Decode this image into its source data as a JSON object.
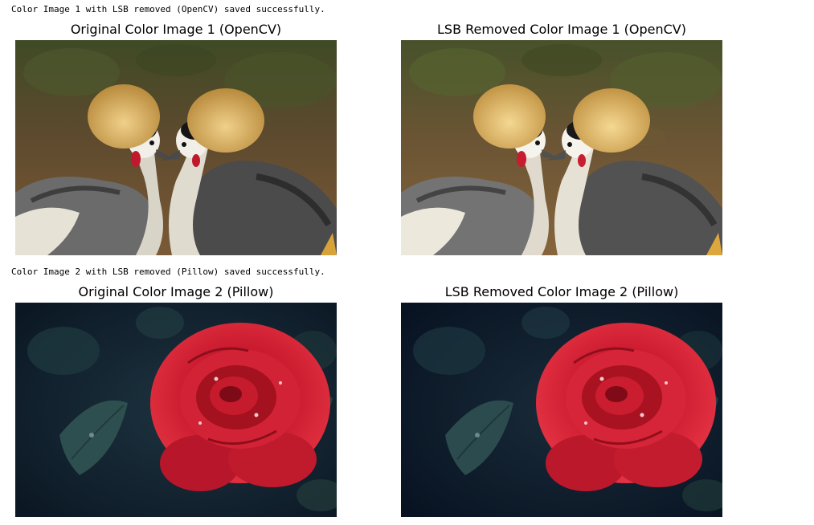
{
  "output": {
    "message_1": "Color Image 1 with LSB removed (OpenCV) saved successfully.",
    "message_2": "Color Image 2 with LSB removed (Pillow) saved successfully."
  },
  "figures": [
    {
      "left_title": "Original Color Image 1 (OpenCV)",
      "right_title": "LSB Removed Color Image 1 (OpenCV)",
      "subject": "two grey crowned cranes with golden crests facing each other"
    },
    {
      "left_title": "Original Color Image 2 (Pillow)",
      "right_title": "LSB Removed Color Image 2 (Pillow)",
      "subject": "red rose with water droplets on dark teal leaves"
    }
  ],
  "colors": {
    "crane_background": "#5e4a2e",
    "crane_crest": "#d8b06a",
    "rose_red": "#c8192e",
    "rose_background": "#0f1f2e"
  }
}
